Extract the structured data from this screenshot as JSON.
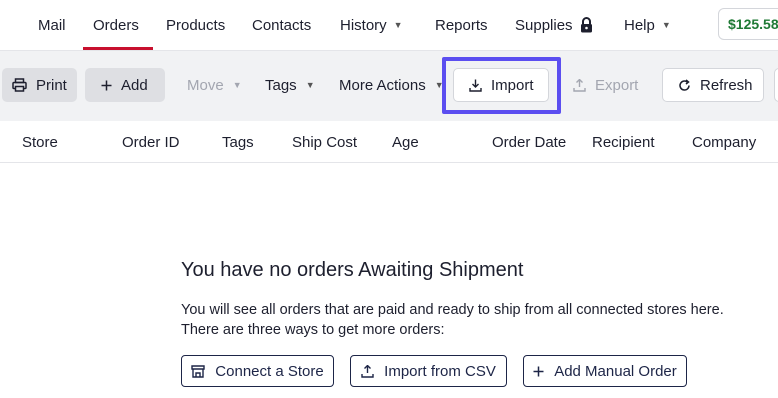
{
  "nav": {
    "items": [
      {
        "label": "Mail"
      },
      {
        "label": "Orders",
        "active": true
      },
      {
        "label": "Products"
      },
      {
        "label": "Contacts"
      },
      {
        "label": "History",
        "has_dropdown": true
      },
      {
        "label": "Reports"
      },
      {
        "label": "Supplies",
        "icon": "lock-icon"
      },
      {
        "label": "Help",
        "has_dropdown": true
      }
    ],
    "balance": "$125.58"
  },
  "toolbar": {
    "print": "Print",
    "add": "Add",
    "move": "Move",
    "tags": "Tags",
    "more_actions": "More Actions",
    "import": "Import",
    "export": "Export",
    "refresh": "Refresh"
  },
  "table": {
    "columns": [
      "Store",
      "Order ID",
      "Tags",
      "Ship Cost",
      "Age",
      "Order Date",
      "Recipient",
      "Company"
    ]
  },
  "empty_state": {
    "title": "You have no orders Awaiting Shipment",
    "line1": "You will see all orders that are paid and ready to ship from all connected stores here.",
    "line2": "There are three ways to get more orders:",
    "connect_store": "Connect a Store",
    "import_csv": "Import from CSV",
    "add_manual": "Add Manual Order"
  },
  "colors": {
    "accent_underline": "#c8102e",
    "highlight_box": "#5b4ef0",
    "balance_text": "#1f7a35",
    "cta_border": "#1d2547"
  }
}
